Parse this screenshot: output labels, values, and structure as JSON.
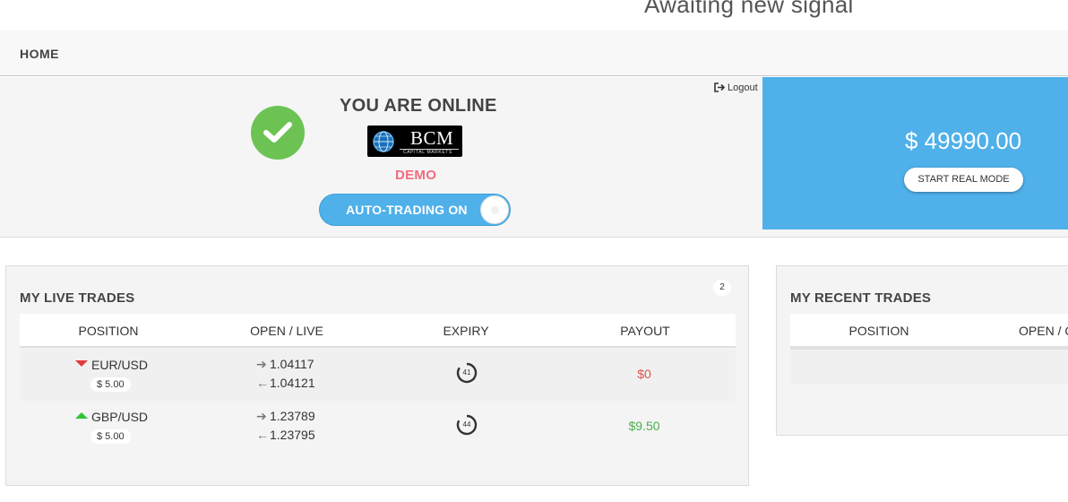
{
  "header": {
    "signal_text": "Awaiting new signal"
  },
  "nav": {
    "home_label": "HOME"
  },
  "status": {
    "title": "YOU ARE ONLINE",
    "broker_logo": {
      "name": "BCM",
      "subtitle": "CAPITAL MARKETS"
    },
    "mode": "DEMO",
    "auto_trading_label": "AUTO-TRADING ON",
    "logout_label": "Logout",
    "online_color": "#6cc354",
    "mode_color": "#f16c7f"
  },
  "balance": {
    "amount": "$ 49990.00",
    "start_real_label": "START REAL MODE",
    "accent_color": "#4fb0ea"
  },
  "live_trades": {
    "title": "MY LIVE TRADES",
    "count": "2",
    "columns": [
      "POSITION",
      "OPEN / LIVE",
      "EXPIRY",
      "PAYOUT"
    ],
    "rows": [
      {
        "direction": "down",
        "pair": "EUR/USD",
        "amount": "$ 5.00",
        "open": "1.04117",
        "live": "1.04121",
        "expiry": "41",
        "payout": "$0",
        "payout_color": "#d9534f"
      },
      {
        "direction": "up",
        "pair": "GBP/USD",
        "amount": "$ 5.00",
        "open": "1.23789",
        "live": "1.23795",
        "expiry": "44",
        "payout": "$9.50",
        "payout_color": "#4cae4c"
      }
    ]
  },
  "recent_trades": {
    "title": "MY RECENT TRADES",
    "columns": [
      "POSITION",
      "OPEN / C"
    ]
  },
  "icons": [
    "check-icon",
    "globe-icon",
    "logout-icon",
    "arrow-down-icon",
    "arrow-up-icon",
    "arrow-right-icon",
    "arrow-left-icon",
    "timer-icon"
  ]
}
